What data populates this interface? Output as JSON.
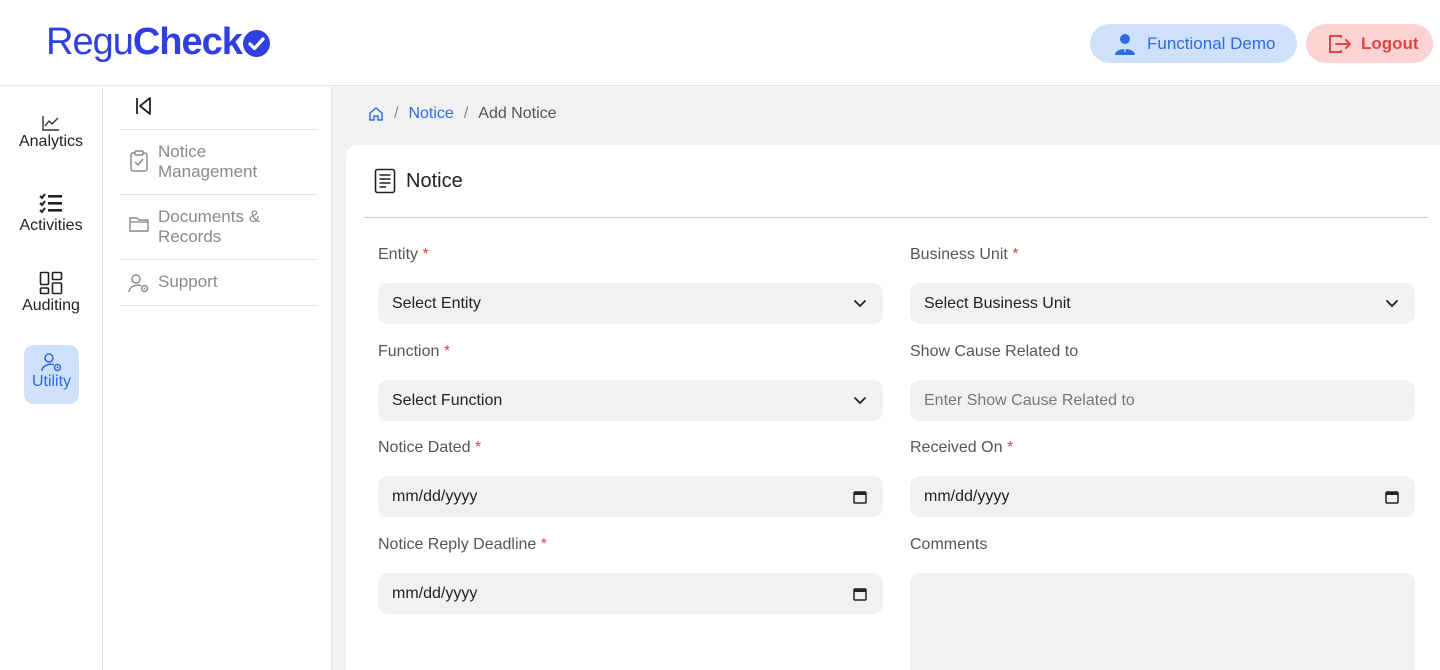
{
  "header": {
    "logo_part1": "Regu",
    "logo_part2": "Check",
    "user_label": "Functional Demo",
    "logout_label": "Logout"
  },
  "rail": {
    "items": [
      {
        "label": "Analytics",
        "icon": "chart-line-icon"
      },
      {
        "label": "Activities",
        "icon": "checklist-icon"
      },
      {
        "label": "Auditing",
        "icon": "dashboard-icon"
      },
      {
        "label": "Utility",
        "icon": "user-gear-icon",
        "active": true
      }
    ]
  },
  "subnav": {
    "items": [
      {
        "label": "Notice Management",
        "icon": "clipboard-check-icon"
      },
      {
        "label": "Documents & Records",
        "icon": "folder-icon"
      },
      {
        "label": "Support",
        "icon": "user-gear-icon"
      }
    ]
  },
  "breadcrumb": {
    "home_icon": "home-icon",
    "items": [
      "Notice",
      "Add Notice"
    ]
  },
  "form": {
    "title": "Notice",
    "fields": {
      "entity": {
        "label": "Entity",
        "required": "*",
        "value": "Select Entity"
      },
      "business_unit": {
        "label": "Business Unit",
        "required": "*",
        "value": "Select Business Unit"
      },
      "function": {
        "label": "Function",
        "required": "*",
        "value": "Select Function"
      },
      "show_cause": {
        "label": "Show Cause Related to",
        "placeholder": "Enter Show Cause Related to"
      },
      "notice_dated": {
        "label": "Notice Dated",
        "required": "*",
        "value": "mm/dd/yyyy"
      },
      "received_on": {
        "label": "Received On",
        "required": "*",
        "value": "mm/dd/yyyy"
      },
      "reply_deadline": {
        "label": "Notice Reply Deadline",
        "required": "*",
        "value": "mm/dd/yyyy"
      },
      "comments": {
        "label": "Comments",
        "value": ""
      }
    }
  },
  "colors": {
    "brand": "#2f3fe0",
    "accent_blue": "#2d6be0",
    "user_bg": "#cfe0fb",
    "logout_bg": "#fbd3d3",
    "logout_fg": "#e04646",
    "field_bg": "#f2f1f2",
    "required": "#e04646"
  }
}
